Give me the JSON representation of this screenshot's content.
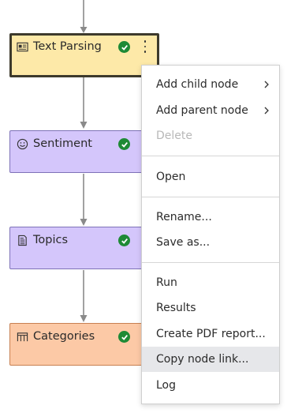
{
  "nodes": [
    {
      "title": "Text Parsing",
      "icon": "text-parsing-icon",
      "status": "success",
      "fill": "#fde9a8",
      "border": "#3d3a2c",
      "selected": true
    },
    {
      "title": "Sentiment",
      "icon": "sentiment-icon",
      "status": "success",
      "fill": "#d4c6fb",
      "border": "#7e72b8",
      "selected": false
    },
    {
      "title": "Topics",
      "icon": "topics-icon",
      "status": "success",
      "fill": "#d4c6fb",
      "border": "#7e72b8",
      "selected": false
    },
    {
      "title": "Categories",
      "icon": "categories-icon",
      "status": "success",
      "fill": "#fcc9a6",
      "border": "#c78052",
      "selected": false
    }
  ],
  "context_menu": {
    "groups": [
      [
        {
          "label": "Add child node",
          "submenu": true,
          "disabled": false
        },
        {
          "label": "Add parent node",
          "submenu": true,
          "disabled": false
        },
        {
          "label": "Delete",
          "submenu": false,
          "disabled": true
        }
      ],
      [
        {
          "label": "Open",
          "submenu": false,
          "disabled": false
        }
      ],
      [
        {
          "label": "Rename...",
          "submenu": false,
          "disabled": false
        },
        {
          "label": "Save as...",
          "submenu": false,
          "disabled": false
        }
      ],
      [
        {
          "label": "Run",
          "submenu": false,
          "disabled": false
        },
        {
          "label": "Results",
          "submenu": false,
          "disabled": false
        },
        {
          "label": "Create PDF report...",
          "submenu": false,
          "disabled": false
        },
        {
          "label": "Copy node link...",
          "submenu": false,
          "disabled": false,
          "highlighted": true
        },
        {
          "label": "Log",
          "submenu": false,
          "disabled": false
        }
      ]
    ]
  },
  "colors": {
    "connector": "#8a8a8a",
    "success": "#1e8a35",
    "menu_hover": "#e6e7ea"
  }
}
